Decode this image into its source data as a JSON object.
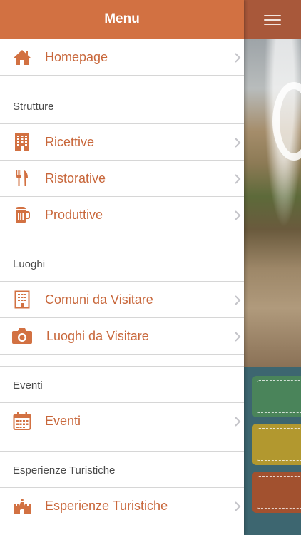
{
  "header": {
    "title": "Menu"
  },
  "items": {
    "homepage": "Homepage",
    "ricettive": "Ricettive",
    "ristorative": "Ristorative",
    "produttive": "Produttive",
    "comuni": "Comuni da Visitare",
    "luoghi": "Luoghi da Visitare",
    "eventi": "Eventi",
    "esperienze": "Esperienze Turistiche"
  },
  "sections": {
    "strutture": "Strutture",
    "luoghi": "Luoghi",
    "eventi": "Eventi",
    "esperienze": "Esperienze Turistiche"
  },
  "colors": {
    "accent": "#d27142",
    "label": "#c8673b",
    "section_text": "#4a4a4a"
  },
  "icons": {
    "homepage": "home-icon",
    "ricettive": "building-icon",
    "ristorative": "cutlery-icon",
    "produttive": "beer-mug-icon",
    "comuni": "office-building-icon",
    "luoghi": "camera-icon",
    "eventi": "calendar-icon",
    "esperienze": "castle-icon",
    "menu_toggle": "hamburger-icon"
  }
}
